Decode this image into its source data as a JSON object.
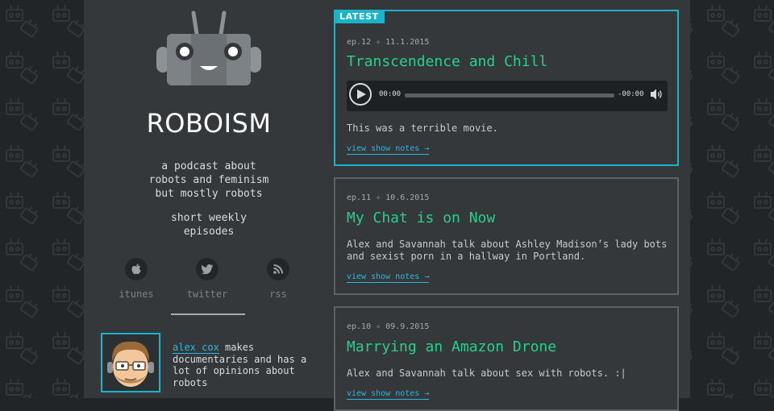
{
  "site": {
    "title": "ROBOISM",
    "tagline": [
      "a podcast about",
      "robots and feminism",
      "but mostly robots"
    ],
    "schedule": [
      "short weekly",
      "episodes"
    ],
    "social": [
      {
        "label": "itunes",
        "icon": "apple-icon"
      },
      {
        "label": "twitter",
        "icon": "twitter-icon"
      },
      {
        "label": "rss",
        "icon": "rss-icon"
      }
    ],
    "host": {
      "name": "alex cox",
      "bio": "makes documentaries and has a lot of opinions about robots"
    }
  },
  "colors": {
    "accent": "#1ab4c8",
    "title_green": "#25d18a",
    "link_blue": "#2ab7e3"
  },
  "episodes": [
    {
      "badge": "LATEST",
      "meta": "ep.12 ✧ 11.1.2015",
      "title": "Transcendence and Chill",
      "player": {
        "current": "00:00",
        "remaining": "-00:00"
      },
      "description": "This was a terrible movie.",
      "link": "view show notes →"
    },
    {
      "meta": "ep.11 ✧ 10.6.2015",
      "title": "My Chat is on Now",
      "description": "Alex and Savannah talk about Ashley Madison’s lady bots and sexist porn in a hallway in Portland.",
      "link": "view show notes →"
    },
    {
      "meta": "ep.10 ✧ 09.9.2015",
      "title": "Marrying an Amazon Drone",
      "description": "Alex and Savannah talk about sex with robots. :|",
      "link": "view show notes →"
    }
  ]
}
